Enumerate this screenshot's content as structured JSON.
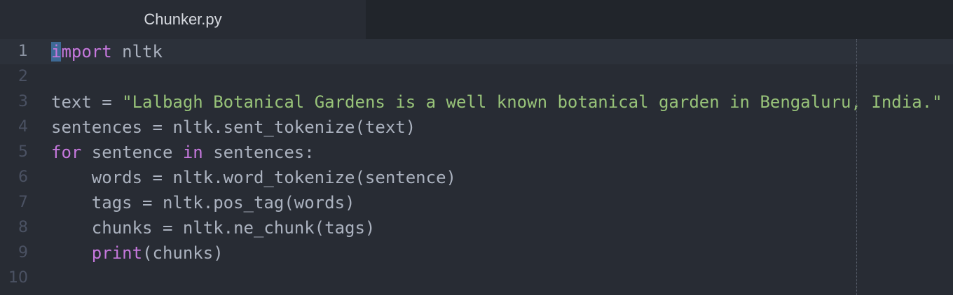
{
  "tab": {
    "title": "Chunker.py"
  },
  "colors": {
    "keyword": "#c678dd",
    "string": "#98c379",
    "plain": "#abb2bf",
    "background": "#282c34"
  },
  "editor": {
    "current_line": 1,
    "lines": [
      {
        "number": "1",
        "tokens": [
          {
            "t": "import",
            "c": "kw"
          },
          {
            "t": " nltk",
            "c": "pl"
          }
        ]
      },
      {
        "number": "2",
        "tokens": []
      },
      {
        "number": "3",
        "tokens": [
          {
            "t": "text = ",
            "c": "pl"
          },
          {
            "t": "\"Lalbagh Botanical Gardens is a well known botanical garden in Bengaluru, India.\"",
            "c": "str"
          }
        ]
      },
      {
        "number": "4",
        "tokens": [
          {
            "t": "sentences = nltk.sent_tokenize(text)",
            "c": "pl"
          }
        ]
      },
      {
        "number": "5",
        "tokens": [
          {
            "t": "for",
            "c": "kw"
          },
          {
            "t": " sentence ",
            "c": "pl"
          },
          {
            "t": "in",
            "c": "kw"
          },
          {
            "t": " sentences:",
            "c": "pl"
          }
        ]
      },
      {
        "number": "6",
        "tokens": [
          {
            "t": "    words = nltk.word_tokenize(sentence)",
            "c": "pl"
          }
        ]
      },
      {
        "number": "7",
        "tokens": [
          {
            "t": "    tags = nltk.pos_tag(words)",
            "c": "pl"
          }
        ]
      },
      {
        "number": "8",
        "tokens": [
          {
            "t": "    chunks = nltk.ne_chunk(tags)",
            "c": "pl"
          }
        ]
      },
      {
        "number": "9",
        "tokens": [
          {
            "t": "    ",
            "c": "pl"
          },
          {
            "t": "print",
            "c": "fn"
          },
          {
            "t": "(chunks)",
            "c": "pl"
          }
        ]
      },
      {
        "number": "10",
        "tokens": []
      }
    ]
  }
}
